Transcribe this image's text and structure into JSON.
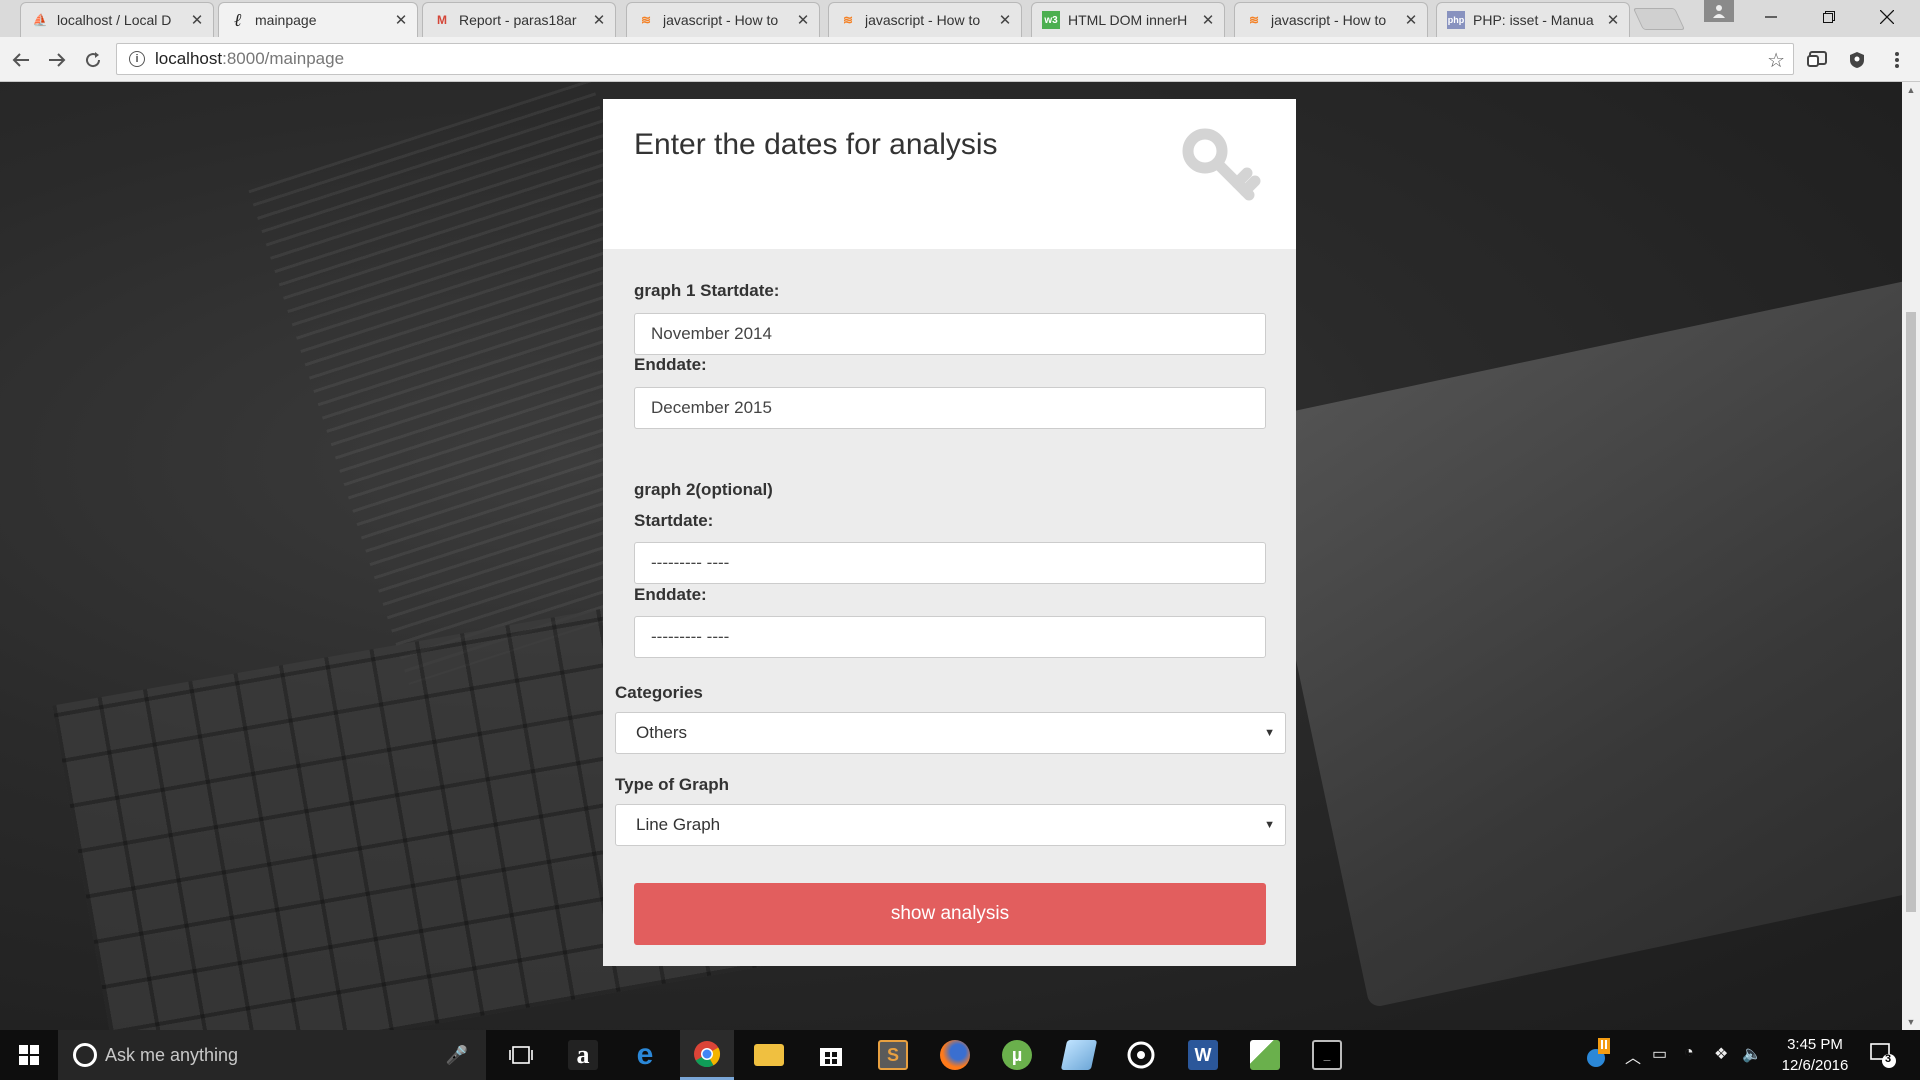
{
  "browser": {
    "tabs": [
      {
        "title": "localhost / Local D",
        "icon": "phpmyadmin-icon",
        "active": false
      },
      {
        "title": "mainpage",
        "icon": "django-icon",
        "active": true
      },
      {
        "title": "Report - paras18ar",
        "icon": "gmail-icon",
        "active": false
      },
      {
        "title": "javascript - How to",
        "icon": "stackoverflow-icon",
        "active": false
      },
      {
        "title": "javascript - How to",
        "icon": "stackoverflow-icon",
        "active": false
      },
      {
        "title": "HTML DOM innerH",
        "icon": "w3schools-icon",
        "active": false
      },
      {
        "title": "javascript - How to",
        "icon": "stackoverflow-icon",
        "active": false
      },
      {
        "title": "PHP: isset - Manua",
        "icon": "php-icon",
        "active": false
      }
    ],
    "tab_close_glyph": "✕",
    "url_host": "localhost",
    "url_path": ":8000/mainpage"
  },
  "form": {
    "title": "Enter the dates for analysis",
    "graph1_start_label": "graph 1 Startdate:",
    "graph1_start_value": "November 2014",
    "graph1_end_label": "Enddate:",
    "graph1_end_value": "December 2015",
    "graph2_heading": "graph 2(optional)",
    "graph2_start_label": "Startdate:",
    "graph2_start_value": "--------- ----",
    "graph2_end_label": "Enddate:",
    "graph2_end_value": "--------- ----",
    "categories_label": "Categories",
    "categories_value": "Others",
    "graph_type_label": "Type of Graph",
    "graph_type_value": "Line Graph",
    "submit_label": "show analysis",
    "accent_color": "#e25e5e"
  },
  "taskbar": {
    "search_placeholder": "Ask me anything",
    "clock_time": "3:45 PM",
    "clock_date": "12/6/2016",
    "notification_count": "3"
  }
}
